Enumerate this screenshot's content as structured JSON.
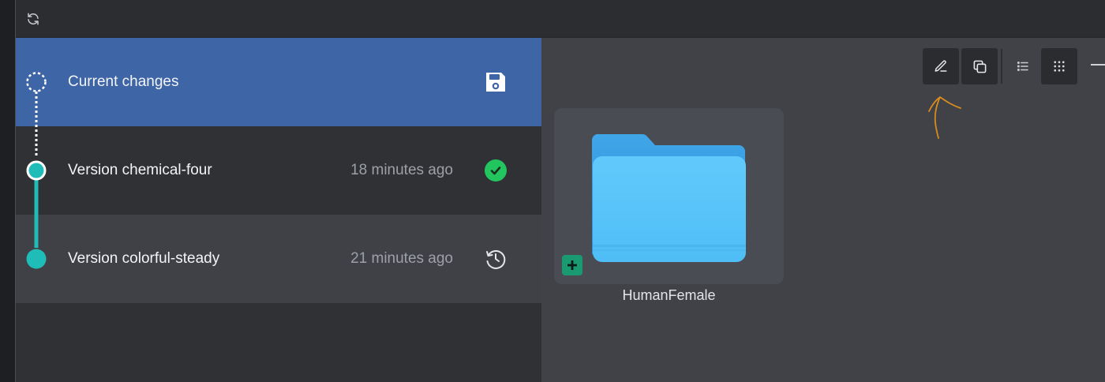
{
  "versions": [
    {
      "name": "Current changes",
      "time": "",
      "action": "save-icon"
    },
    {
      "name": "Version chemical-four",
      "time": "18 minutes ago",
      "action": "check-circle-icon"
    },
    {
      "name": "Version colorful-steady",
      "time": "21 minutes ago",
      "action": "restore-history-icon"
    }
  ],
  "content": {
    "folder": {
      "name": "HumanFemale"
    }
  },
  "colors": {
    "selected_row": "#3e65a6",
    "timeline": "#1fbcb8",
    "success": "#22c55e",
    "folder": "#5ac8fa",
    "add_badge": "#1a9a70",
    "annotation": "#d98c1e"
  }
}
